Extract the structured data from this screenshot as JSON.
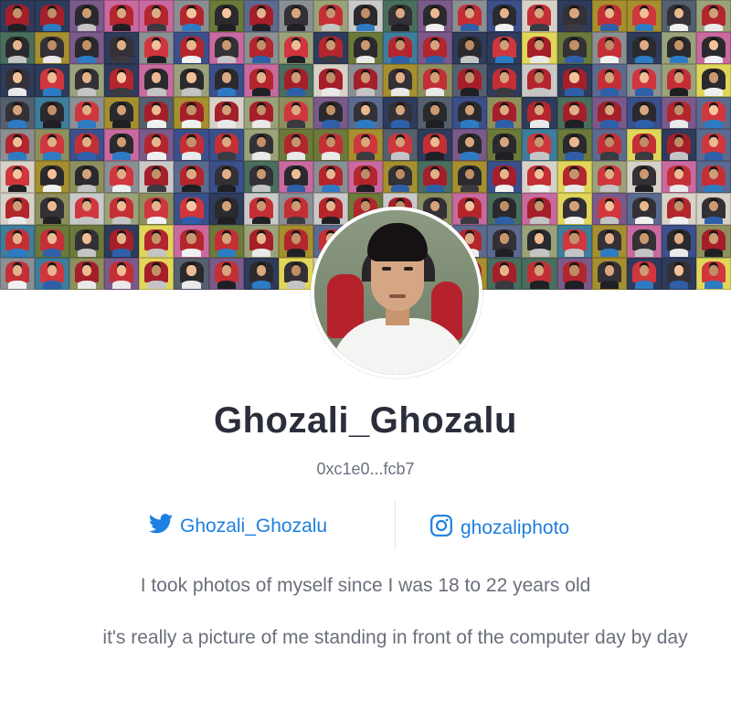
{
  "profile": {
    "username": "Ghozali_Ghozalu",
    "wallet_address": "0xc1e0...fcb7",
    "avatar_icon": "profile-photo",
    "banner_icon": "photo-collage"
  },
  "socials": {
    "twitter": {
      "label": "Ghozali_Ghozalu",
      "icon": "twitter-icon"
    },
    "instagram": {
      "label": "ghozaliphoto",
      "icon": "instagram-icon"
    }
  },
  "bio": {
    "line1": "I took photos of myself since I was 18 to 22 years old",
    "line2": "it's really a picture of me standing in front of the computer day by day"
  },
  "colors": {
    "link": "#1d7fe0",
    "name": "#2b2e3a",
    "muted": "#6a6f7a"
  }
}
